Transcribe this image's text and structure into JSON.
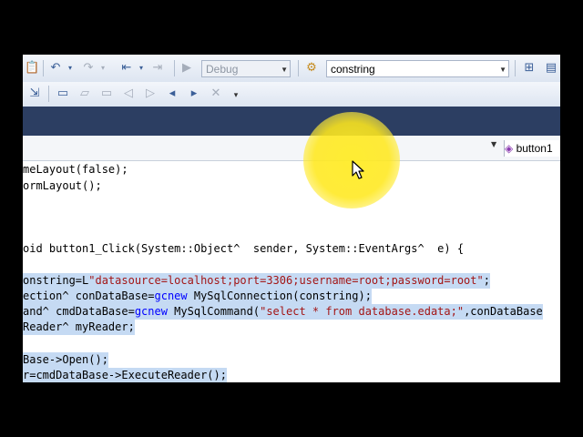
{
  "toolbar": {
    "debug_label": "Debug",
    "config_value": "constring"
  },
  "navigation": {
    "member_label": "button1"
  },
  "editor": {
    "line1": "meLayout(false);",
    "line2": "ormLayout();",
    "line3": "oid button1_Click(System::Object^  sender, System::EventArgs^  e) {",
    "line4_pre": "onstring=L",
    "line4_str": "\"datasource=localhost;port=3306;username=root;password=root\"",
    "line4_post": ";",
    "line5_pre": "ection^ conDataBase=",
    "line5_kw": "gcnew",
    "line5_post": " MySqlConnection(constring);",
    "line6_pre": "and^ cmdDataBase=",
    "line6_kw": "gcnew",
    "line6_mid": " MySqlCommand(",
    "line6_str": "\"select * from database.edata;\"",
    "line6_post": ",conDataBase",
    "line7": "Reader^ myReader;",
    "line8": "Base->Open();",
    "line9": "r=cmdDataBase->ExecuteReader();"
  },
  "colors": {
    "keyword": "#0000ff",
    "string": "#a31515",
    "selection": "#c5daf3",
    "cursor_highlight": "#ffe81e"
  }
}
